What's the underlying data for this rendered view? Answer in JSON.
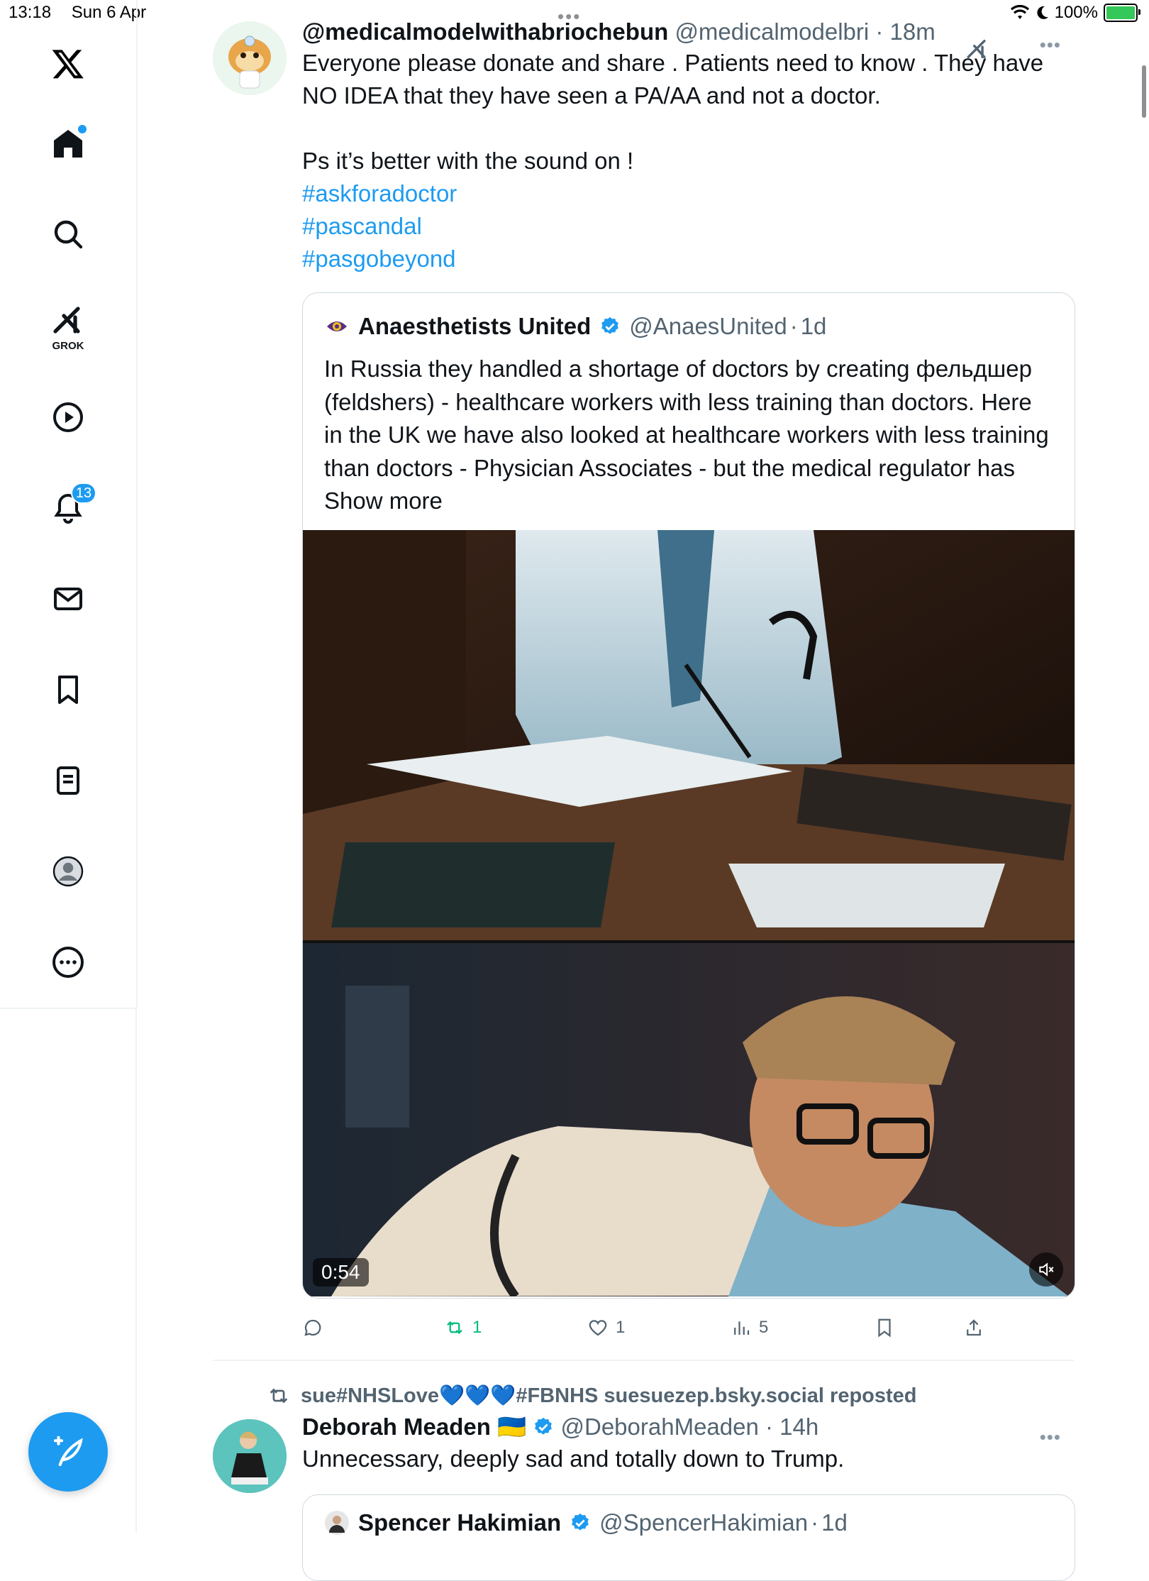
{
  "status_bar": {
    "time": "13:18",
    "date": "Sun 6 Apr",
    "battery": "100%",
    "battery_level": 1.0
  },
  "sidebar": {
    "items": [
      {
        "name": "x-logo"
      },
      {
        "name": "home",
        "has_dot": true
      },
      {
        "name": "search"
      },
      {
        "name": "grok",
        "label": "GROK"
      },
      {
        "name": "video"
      },
      {
        "name": "notifications",
        "badge": "13"
      },
      {
        "name": "messages"
      },
      {
        "name": "bookmarks"
      },
      {
        "name": "lists"
      },
      {
        "name": "profile"
      },
      {
        "name": "more"
      }
    ]
  },
  "post1": {
    "display_name": "@medicalmodelwithabriochebun",
    "handle": "@medicalmodelbri",
    "time": "18m",
    "text": "Everyone please donate and share . Patients need to know . They have NO IDEA that they have seen a PA/AA and not a doctor.\n\nPs it’s better with the sound on !",
    "hashtags": [
      "#askforadoctor",
      "#pascandal",
      "#pasgobeyond"
    ],
    "quote": {
      "display_name": "Anaesthetists United",
      "handle": "@AnaesUnited",
      "time": "1d",
      "text": "In Russia they handled a shortage of doctors by creating фельдшер (feldshers) - healthcare workers with less training than doctors. Here in the UK we have also looked at healthcare workers with less training than doctors - Physician Associates - but the medical regulator has",
      "show_more": "Show more",
      "video_duration": "0:54"
    },
    "actions": {
      "replies": "",
      "reposts": "1",
      "likes": "1",
      "views": "5"
    }
  },
  "post2": {
    "repost_by": "sue#NHSLove💙💙💙#FBNHS suesuezep.bsky.social reposted",
    "display_name": "Deborah Meaden 🇺🇦",
    "handle": "@DeborahMeaden",
    "time": "14h",
    "text": "Unnecessary, deeply sad and totally down to Trump.",
    "quote": {
      "display_name": "Spencer Hakimian",
      "handle": "@SpencerHakimian",
      "time": "1d"
    }
  },
  "colors": {
    "accent": "#1d9bf0",
    "repost_green": "#00ba7c",
    "muted": "#536471"
  }
}
